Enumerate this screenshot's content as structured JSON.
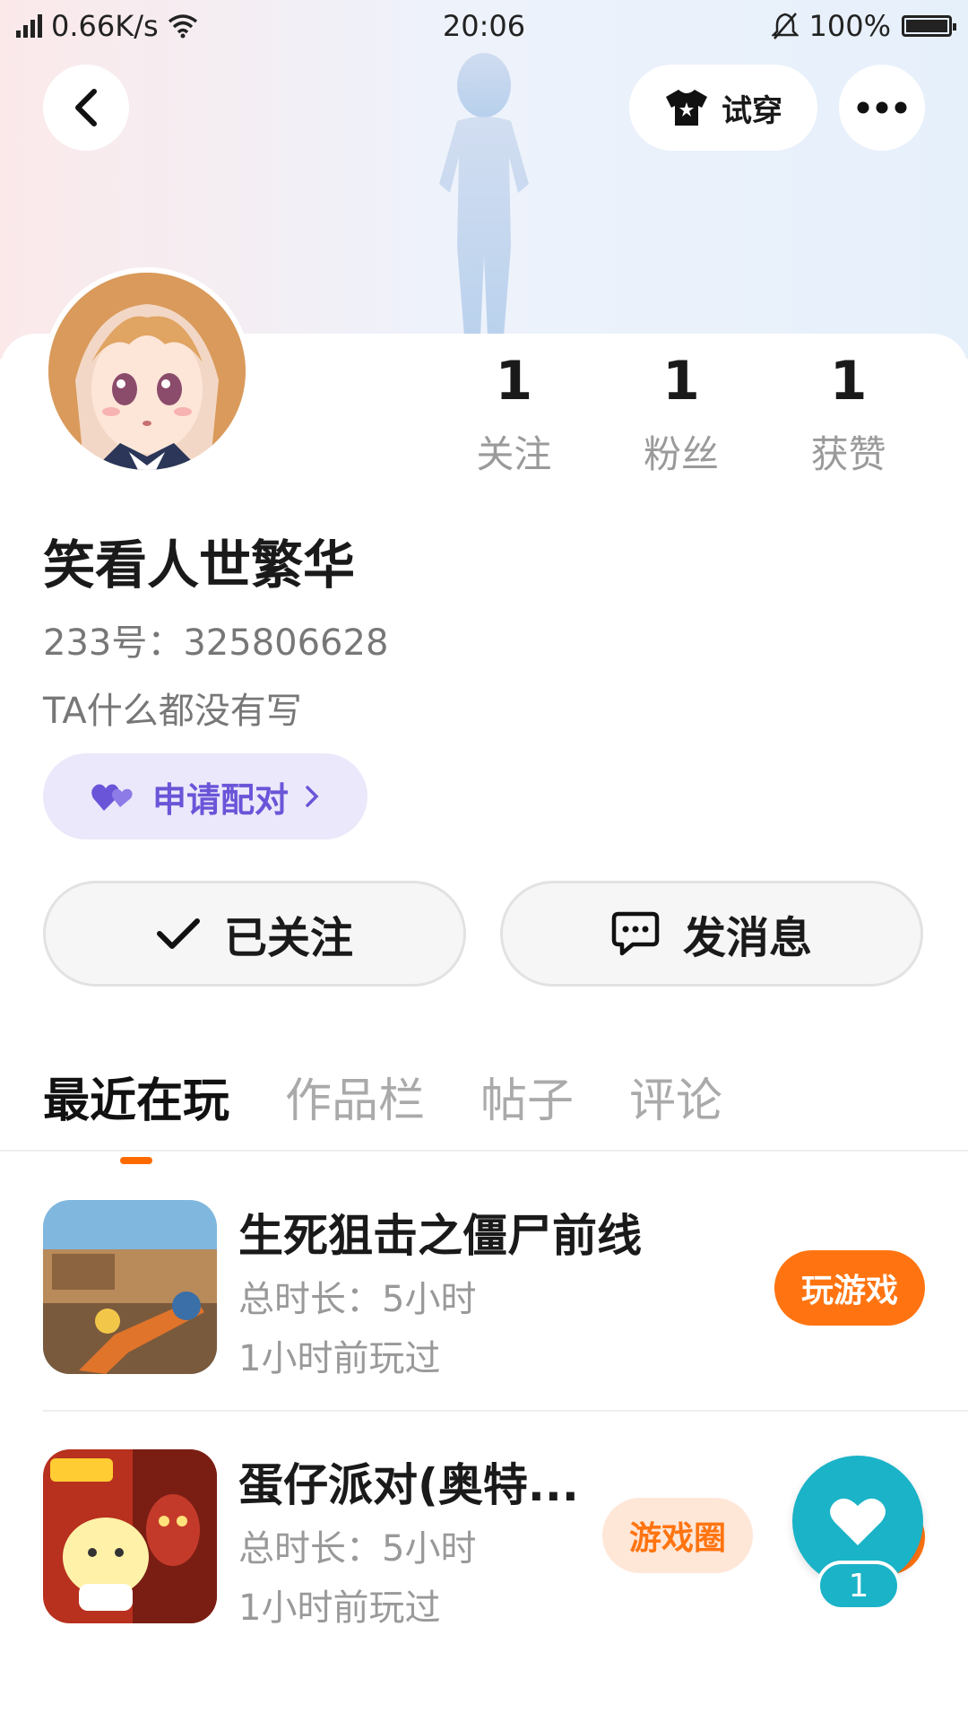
{
  "status_bar": {
    "network": "4G",
    "speed": "0.66K/s",
    "time": "20:06",
    "battery": "100%"
  },
  "header": {
    "try_on_label": "试穿"
  },
  "profile": {
    "name": "笑看人世繁华",
    "id_line": "233号：325806628",
    "bio": "TA什么都没有写",
    "pair_label": "申请配对",
    "stats": [
      {
        "value": "1",
        "label": "关注"
      },
      {
        "value": "1",
        "label": "粉丝"
      },
      {
        "value": "1",
        "label": "获赞"
      }
    ]
  },
  "actions": {
    "follow_label": "已关注",
    "message_label": "发消息"
  },
  "tabs": [
    {
      "label": "最近在玩",
      "active": true
    },
    {
      "label": "作品栏",
      "active": false
    },
    {
      "label": "帖子",
      "active": false
    },
    {
      "label": "评论",
      "active": false
    }
  ],
  "games": [
    {
      "title": "生死狙击之僵尸前线",
      "duration": "总时长：5小时",
      "last_played": "1小时前玩过",
      "play_label": "玩游戏"
    },
    {
      "title": "蛋仔派对(奥特...",
      "duration": "总时长：5小时",
      "last_played": "1小时前玩过",
      "circle_label": "游戏圈"
    }
  ],
  "floating_like": {
    "count": "1"
  },
  "colors": {
    "accent": "#ff7411",
    "pair_text": "#6a55d8",
    "pair_bg": "#ebe8fb",
    "like_bg": "#1bb3c7"
  }
}
